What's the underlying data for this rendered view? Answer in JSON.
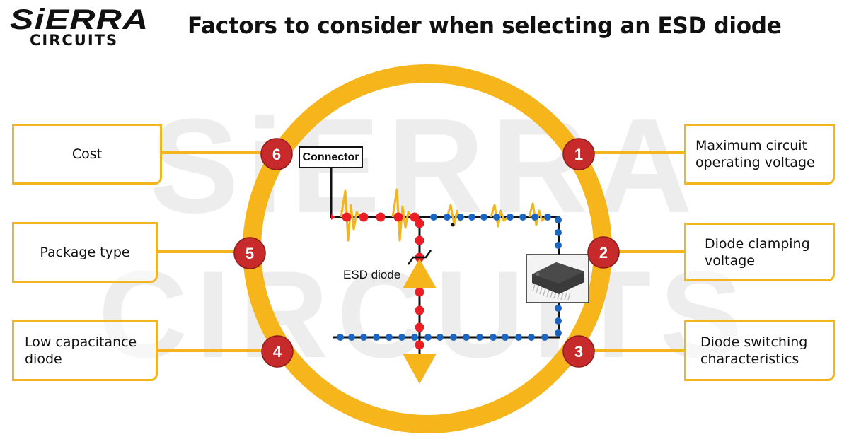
{
  "logo": {
    "top": "SiERRA",
    "bottom": "CIRCUITS"
  },
  "title": "Factors to consider when selecting an ESD diode",
  "watermark": {
    "line1": "SiERRA",
    "line2": "CIRCUITS"
  },
  "colors": {
    "ring": "#f7b51c",
    "badge": "#c62a2a",
    "box_border": "#f2b51e",
    "signal_dot_esd": "#ee1c24",
    "signal_dot_normal": "#1a66c2",
    "spike": "#f2b51e",
    "watermark": "#ececec"
  },
  "factors": [
    {
      "number": "1",
      "label": "Maximum circuit operating voltage",
      "lines": [
        "Maximum circuit",
        "operating voltage"
      ],
      "side": "right"
    },
    {
      "number": "2",
      "label": "Diode clamping voltage",
      "lines": [
        "Diode clamping",
        "voltage"
      ],
      "side": "right"
    },
    {
      "number": "3",
      "label": "Diode switching characteristics",
      "lines": [
        "Diode switching",
        "characteristics"
      ],
      "side": "right"
    },
    {
      "number": "4",
      "label": "Low capacitance diode",
      "lines": [
        "Low capacitance",
        "diode"
      ],
      "side": "left"
    },
    {
      "number": "5",
      "label": "Package type",
      "lines": [
        "Package type"
      ],
      "side": "left"
    },
    {
      "number": "6",
      "label": "Cost",
      "lines": [
        "Cost"
      ],
      "side": "left"
    }
  ],
  "circuit": {
    "connector_label": "Connector",
    "esd_diode_label": "ESD diode",
    "ic_icon": "ic-chip-icon"
  }
}
